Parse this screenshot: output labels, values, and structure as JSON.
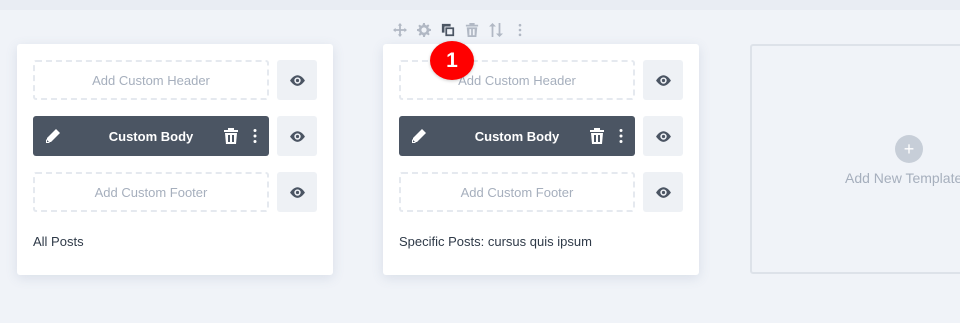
{
  "toolbar": {
    "icons": [
      "move-icon",
      "settings-icon",
      "duplicate-icon",
      "delete-icon",
      "sort-icon",
      "more-icon"
    ]
  },
  "badge": {
    "number": "1",
    "color": "#ff0000"
  },
  "templates": [
    {
      "header": "Add Custom Header",
      "body": "Custom Body",
      "footer": "Add Custom Footer",
      "assignment": "All Posts"
    },
    {
      "header": "Add Custom Header",
      "body": "Custom Body",
      "footer": "Add Custom Footer",
      "assignment": "Specific Posts: cursus quis ipsum"
    }
  ],
  "add_template": {
    "label": "Add New Template",
    "icon": "plus-icon"
  },
  "colors": {
    "accent": "#4b5563",
    "page_bg": "#f0f3f8",
    "muted_text": "#a6afbd"
  }
}
